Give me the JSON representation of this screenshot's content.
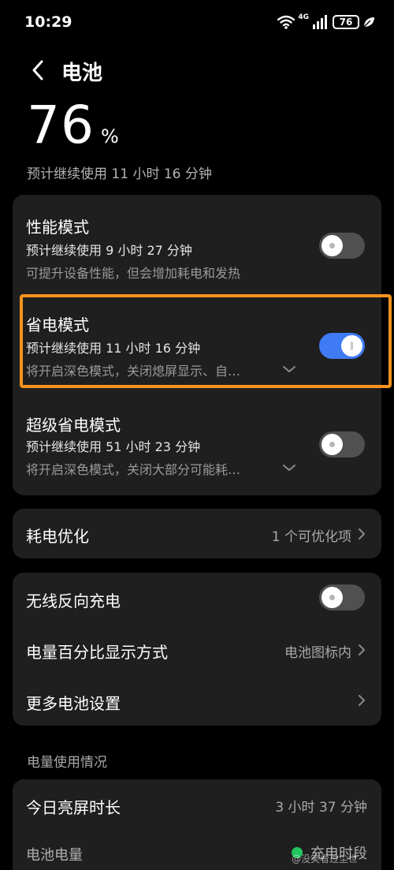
{
  "status_bar": {
    "time": "10:29",
    "network": "4G",
    "battery": "76",
    "icons": [
      "wifi-icon",
      "signal-icon",
      "battery-icon",
      "leaf-icon"
    ]
  },
  "header": {
    "title": "电池",
    "back_icon": "chevron-left-icon"
  },
  "battery": {
    "level": "76",
    "unit": "%",
    "remaining": "预计继续使用 11 小时 16 分钟"
  },
  "modes": [
    {
      "title": "性能模式",
      "remaining": "预计继续使用 9 小时 27 分钟",
      "desc": "可提升设备性能，但会增加耗电和发热",
      "enabled": false
    },
    {
      "title": "省电模式",
      "remaining": "预计继续使用 11 小时 16 分钟",
      "desc": "将开启深色模式，关闭熄屏显示、自…",
      "enabled": true
    },
    {
      "title": "超级省电模式",
      "remaining": "预计继续使用 51 小时 23 分钟",
      "desc": "将开启深色模式，关闭大部分可能耗…",
      "enabled": false
    }
  ],
  "optimize": {
    "label": "耗电优化",
    "value": "1 个可优化项"
  },
  "settings": {
    "reverse_charging": {
      "label": "无线反向充电",
      "enabled": false
    },
    "percent_display": {
      "label": "电量百分比显示方式",
      "value": "电池图标内"
    },
    "more": {
      "label": "更多电池设置"
    }
  },
  "usage": {
    "section_title": "电量使用情况",
    "screen_time_label": "今日亮屏时长",
    "screen_time_value": "3 小时 37 分钟",
    "battery_label": "电池电量",
    "legend_label": "充电时段"
  },
  "watermark": "@没笑看过尘世",
  "colors": {
    "accent": "#3f7bf5",
    "highlight": "#f7931e",
    "card": "#1f1f1f",
    "charging": "#22c55e"
  }
}
